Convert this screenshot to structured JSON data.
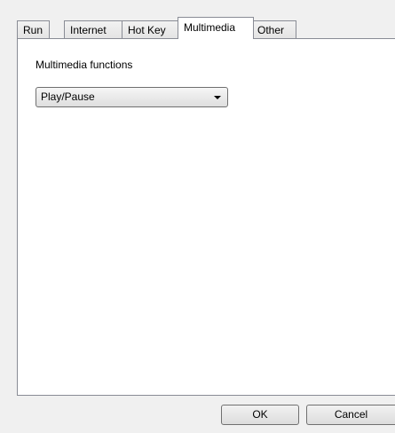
{
  "tabs": [
    {
      "label": "Run",
      "active": false
    },
    {
      "label": "Internet",
      "active": false
    },
    {
      "label": "Hot Key",
      "active": false
    },
    {
      "label": "Multimedia",
      "active": true
    },
    {
      "label": "Other",
      "active": false
    }
  ],
  "panel": {
    "label": "Multimedia functions",
    "combo_value": "Play/Pause"
  },
  "buttons": {
    "ok_label": "OK",
    "cancel_label": "Cancel"
  }
}
